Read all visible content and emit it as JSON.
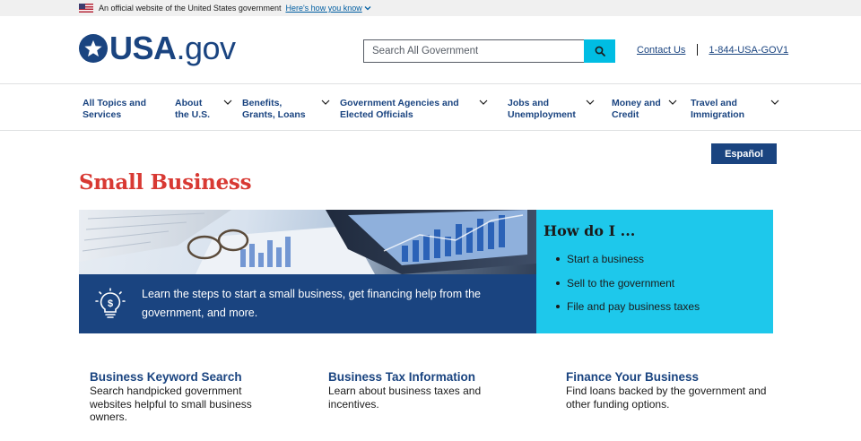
{
  "banner": {
    "text": "An official website of the United States government",
    "link": "Here's how you know"
  },
  "header": {
    "logo_bold": "USA",
    "logo_rest": ".gov",
    "search_placeholder": "Search All Government",
    "contact_label": "Contact Us",
    "phone_label": "1-844-USA-GOV1"
  },
  "nav": {
    "items": [
      {
        "line1": "All Topics and",
        "line2": "Services"
      },
      {
        "line1": "About",
        "line2": "the U.S."
      },
      {
        "line1": "Benefits,",
        "line2": "Grants, Loans"
      },
      {
        "line1": "Government Agencies and",
        "line2": "Elected Officials"
      },
      {
        "line1": "Jobs and",
        "line2": "Unemployment"
      },
      {
        "line1": "Money and",
        "line2": "Credit"
      },
      {
        "line1": "Travel and",
        "line2": "Immigration"
      }
    ]
  },
  "language_button": "Español",
  "page_title": "Small Business",
  "hero": {
    "caption": "Learn the steps to start a small business, get financing help from the government, and more.",
    "howdo_title": "How do I ...",
    "howdo_items": [
      "Start a business",
      "Sell to the government",
      "File and pay business taxes"
    ]
  },
  "cards": [
    {
      "title": "Business Keyword Search",
      "text": "Search handpicked government websites helpful to small business owners."
    },
    {
      "title": "Business Tax Information",
      "text": "Learn about business taxes and incentives."
    },
    {
      "title": "Finance Your Business",
      "text": "Find loans backed by the government and other funding options."
    }
  ],
  "colors": {
    "primary_dark": "#1a4480",
    "accent_cyan": "#1ec8eb",
    "title_red": "#d83933",
    "banner_bg": "#f0f0f0"
  }
}
